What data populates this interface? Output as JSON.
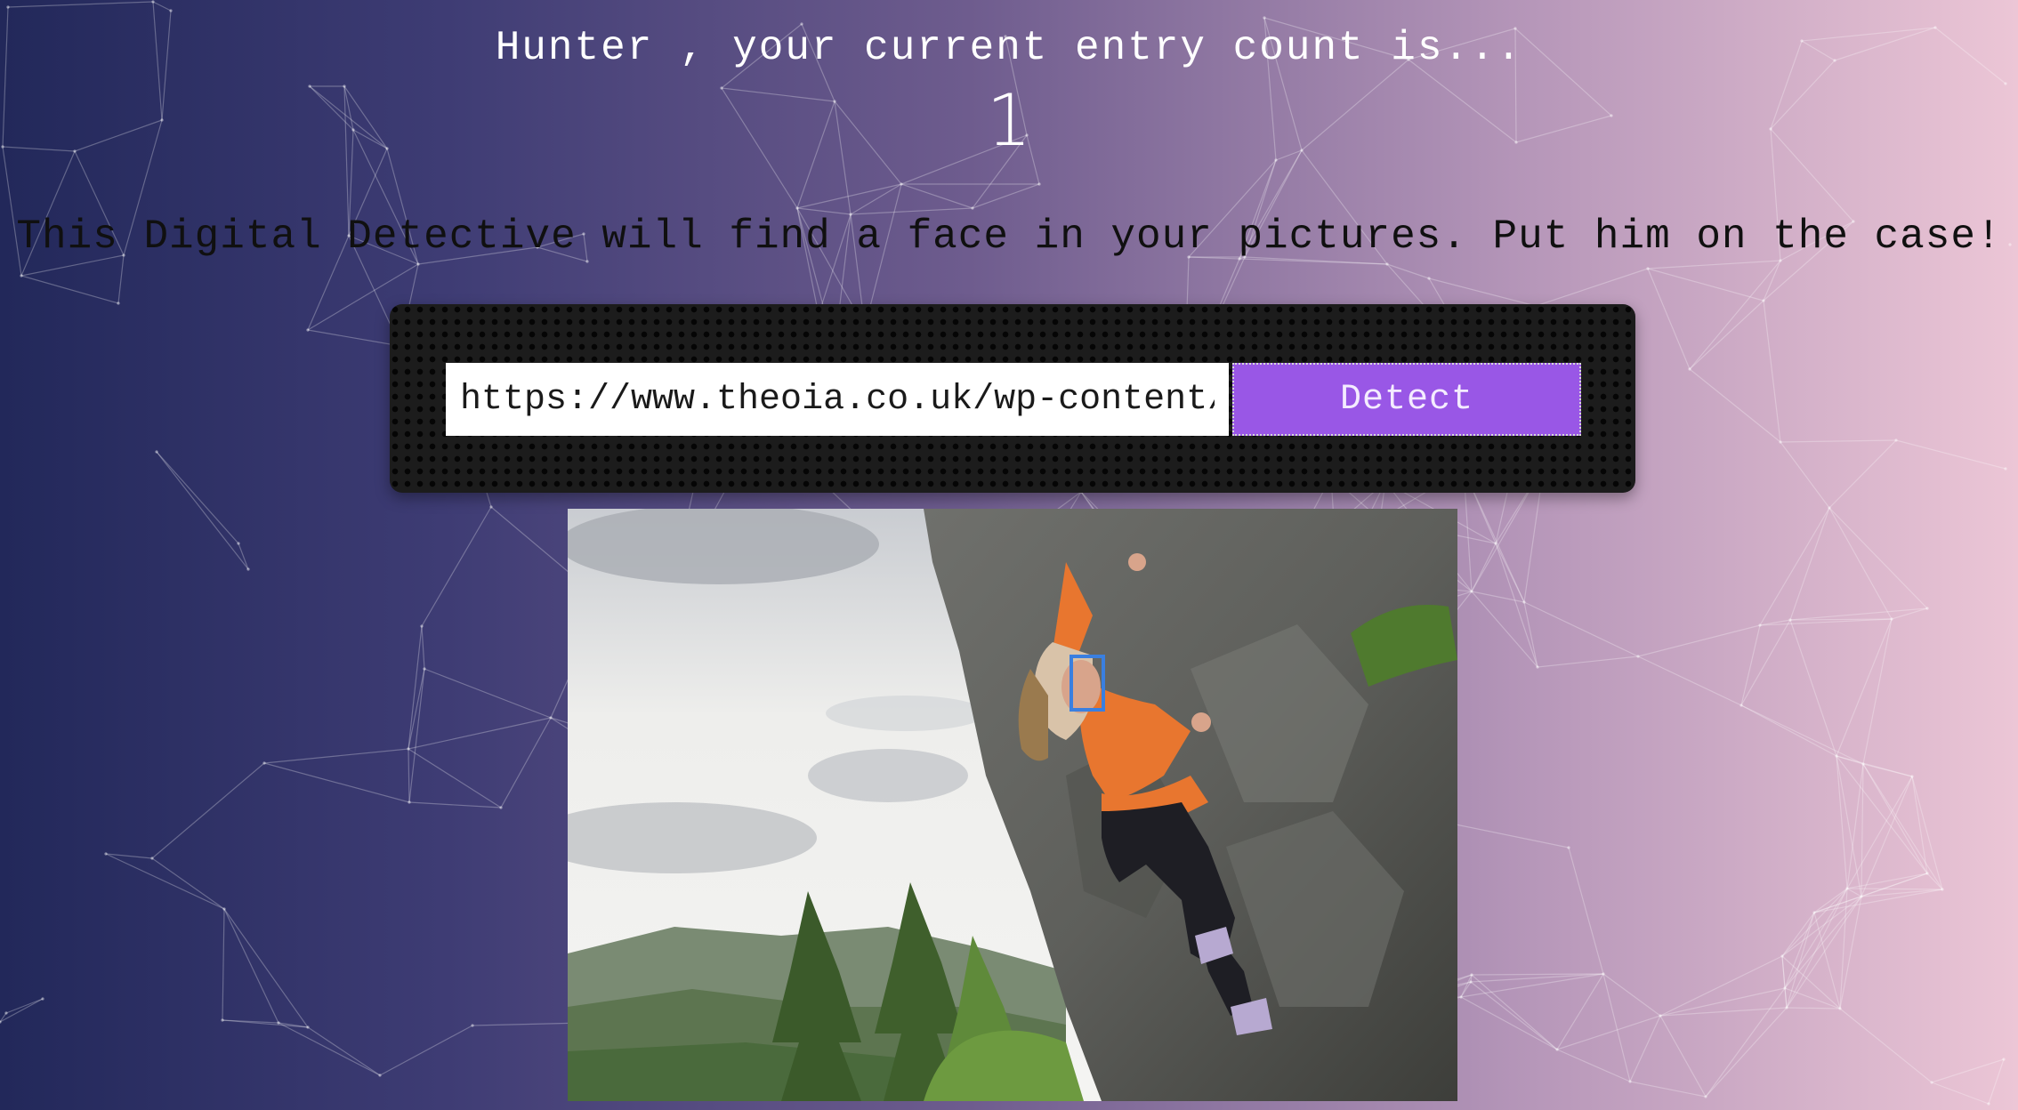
{
  "rank": {
    "message": "Hunter , your current entry count is...",
    "count": "1"
  },
  "intro": {
    "text": "This Digital Detective will find a face in your pictures. Put him on the case!"
  },
  "form": {
    "url_value": "https://www.theoia.co.uk/wp-content/",
    "detect_label": "Detect"
  },
  "image": {
    "description_icon": "climber-photo",
    "face_box_color": "#3a7fe0",
    "faces_detected": 1
  },
  "colors": {
    "button": "#9957e6",
    "panel": "#1c1c1c",
    "gradient_left": "#22285a",
    "gradient_right": "#ecc6d6"
  }
}
